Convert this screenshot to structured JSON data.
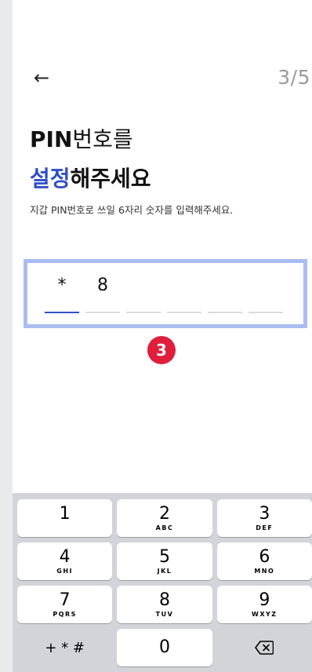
{
  "header": {
    "back_icon": "left-arrow-icon",
    "step": "3/5"
  },
  "title": {
    "line1_bold": "PIN",
    "line1_rest": "번호를",
    "line2_accent": "설정",
    "line2_rest": "해주세요"
  },
  "subtitle": "지갑 PIN번호로 쓰일 6자리 숫자를 입력해주세요.",
  "pin": {
    "slots": [
      "*",
      "8",
      "",
      "",
      "",
      ""
    ],
    "active_index": 0
  },
  "badge": {
    "label": "3",
    "color": "#e01e3c"
  },
  "keypad": {
    "keys": [
      {
        "num": "1",
        "letters": ""
      },
      {
        "num": "2",
        "letters": "ABC"
      },
      {
        "num": "3",
        "letters": "DEF"
      },
      {
        "num": "4",
        "letters": "GHI"
      },
      {
        "num": "5",
        "letters": "JKL"
      },
      {
        "num": "6",
        "letters": "MNO"
      },
      {
        "num": "7",
        "letters": "PQRS"
      },
      {
        "num": "8",
        "letters": "TUV"
      },
      {
        "num": "9",
        "letters": "WXYZ"
      }
    ],
    "symbols": "+ * #",
    "zero": "0",
    "delete_icon": "backspace-icon"
  },
  "colors": {
    "accent": "#2f4fc9",
    "pin_border": "#a9bdf1"
  }
}
